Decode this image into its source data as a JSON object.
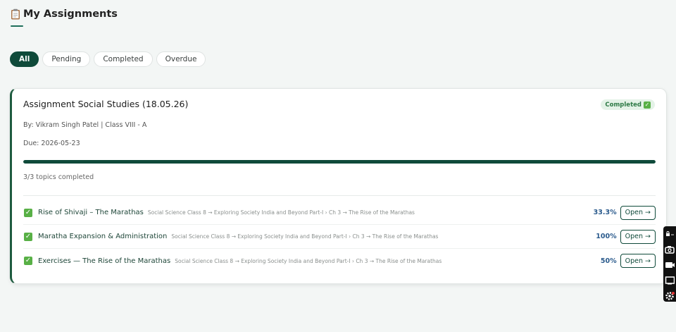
{
  "header": {
    "title": "My Assignments",
    "icon": "clipboard-icon"
  },
  "filters": [
    {
      "label": "All",
      "active": true
    },
    {
      "label": "Pending",
      "active": false
    },
    {
      "label": "Completed",
      "active": false
    },
    {
      "label": "Overdue",
      "active": false
    }
  ],
  "assignment": {
    "title": "Assignment Social Studies (18.05.26)",
    "status": "Completed",
    "by": "By: Vikram Singh Patel | Class VIII - A",
    "due": "Due: 2026-05-23",
    "progress_fraction": 1.0,
    "topics_completed": "3/3 topics completed",
    "topics": [
      {
        "name": "Rise of Shivaji – The Marathas",
        "path": "Social Science Class 8 → Exploring Society India and Beyond Part-I › Ch 3 → The Rise of the Marathas",
        "percent": "33.3%",
        "open_label": "Open →"
      },
      {
        "name": "Maratha Expansion & Administration",
        "path": "Social Science Class 8 → Exploring Society India and Beyond Part-I › Ch 3 → The Rise of the Marathas",
        "percent": "100%",
        "open_label": "Open →"
      },
      {
        "name": "Exercises — The Rise of the Marathas",
        "path": "Social Science Class 8 → Exploring Society India and Beyond Part-I › Ch 3 → The Rise of the Marathas",
        "percent": "50%",
        "open_label": "Open →"
      }
    ]
  },
  "colors": {
    "accent": "#0f4a3a",
    "card_border": "#1e5b3f",
    "check": "#58b046",
    "percent": "#2a5a8c"
  },
  "side_toolbar": {
    "icons": [
      "lock-icon",
      "camera-icon",
      "video-icon",
      "screen-icon",
      "gear-icon"
    ]
  }
}
